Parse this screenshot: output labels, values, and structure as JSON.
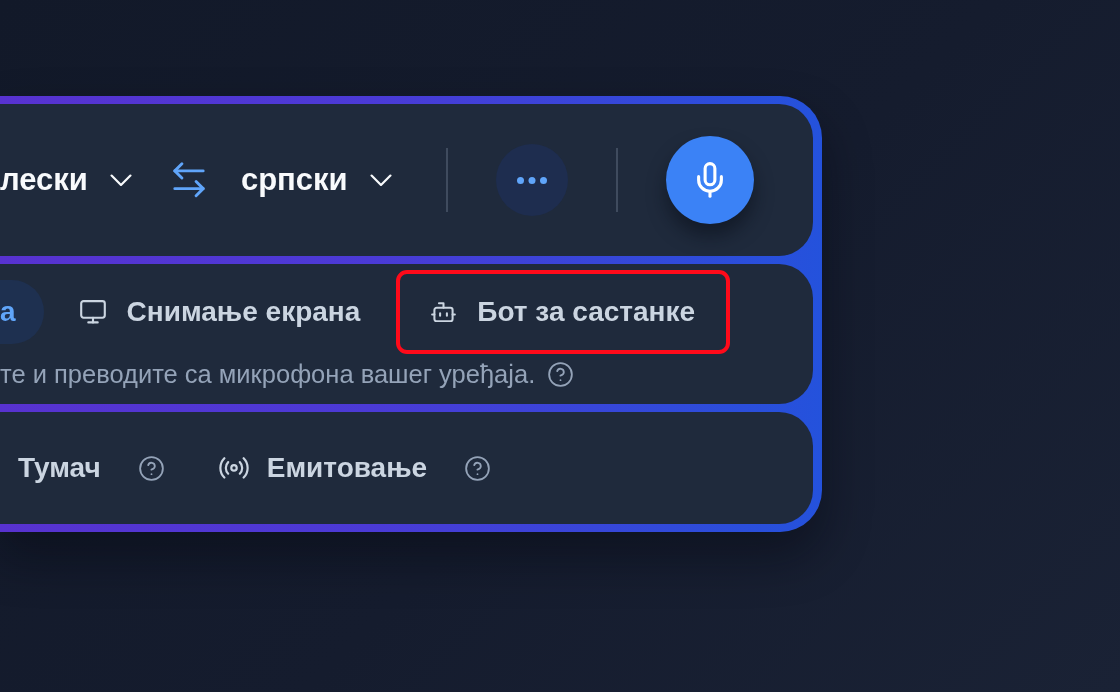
{
  "language_bar": {
    "source_language": "лески",
    "target_language": "српски"
  },
  "input_modes": {
    "tabs": [
      {
        "label": "а",
        "selected": true,
        "highlighted": false
      },
      {
        "label": "Снимање екрана",
        "selected": false,
        "highlighted": false
      },
      {
        "label": "Бот за састанке",
        "selected": false,
        "highlighted": true
      }
    ],
    "description": "те и преводите са микрофона вашег уређаја."
  },
  "modes": [
    {
      "label": "Тумач"
    },
    {
      "label": "Емитовање"
    }
  ]
}
